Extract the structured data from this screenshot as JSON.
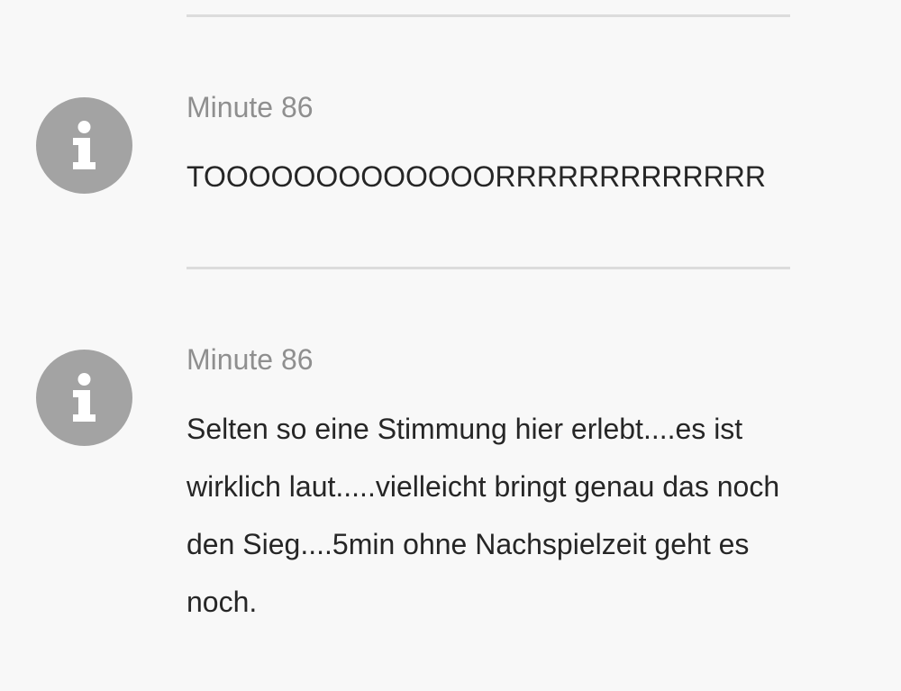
{
  "feed": {
    "entries": [
      {
        "icon": "info-icon",
        "minute": "Minute 86",
        "text": "TOOOOOOOOOOOOORRRRRRRRRRRRR"
      },
      {
        "icon": "info-icon",
        "minute": "Minute 86",
        "text": "Selten so eine Stimmung hier erlebt....es ist wirklich laut.....vielleicht bringt genau das noch den Sieg....5min ohne Nachspielzeit geht es noch."
      }
    ]
  },
  "colors": {
    "background": "#f8f8f8",
    "icon_circle": "#a3a3a3",
    "minute_text": "#8f8f8f",
    "body_text": "#262626",
    "divider": "#dcdcdc"
  }
}
